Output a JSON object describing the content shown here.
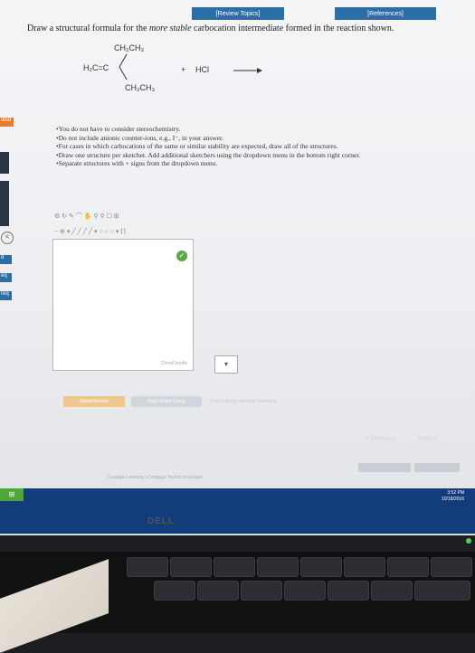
{
  "topbar": {
    "review_topics": "[Review Topics]",
    "references": "[References]"
  },
  "question": {
    "prompt_start": "Draw a structural formula for the ",
    "prompt_emphasis": "more stable",
    "prompt_end": " carbocation intermediate formed in the reaction shown."
  },
  "reaction": {
    "substituent_top": "CH₂CH₃",
    "alkene": "H₂C=C",
    "substituent_bottom": "CH₂CH₃",
    "plus": "+",
    "reagent": "HCl"
  },
  "instructions": [
    "You do not have to consider stereochemistry.",
    "Do not include anionic counter-ions, e.g., I⁻, in your answer.",
    "For cases in which carbocations of the same or similar stability are expected, draw all of the structures.",
    "Draw one structure per sketcher. Add additional sketchers using the dropdown menu in the bottom right corner.",
    "Separate structures with + signs from the dropdown menu."
  ],
  "left_rail": {
    "started_label": "sted",
    "labels": [
      "d",
      "eq",
      "req"
    ]
  },
  "sketcher": {
    "footer_label": "ChemDoodle"
  },
  "buttons": {
    "submit": "Submit Answer",
    "retry": "Retry Entire Group"
  },
  "attempts_text": "1 more group attempts remaining",
  "navigation": {
    "previous": "< Previous",
    "next": "Next >"
  },
  "footer": {
    "text": "Cengage Learning | Cengage Technical Support"
  },
  "taskbar": {
    "time": "3:52 PM",
    "date": "10/18/2016"
  },
  "brand": {
    "monitor_logo": "DELL"
  },
  "colors": {
    "link_blue": "#2d6ea8",
    "started_orange": "#e67b32",
    "submit_orange": "#f0c88e",
    "taskbar_blue": "#123c7a",
    "ok_green": "#5aa842"
  }
}
